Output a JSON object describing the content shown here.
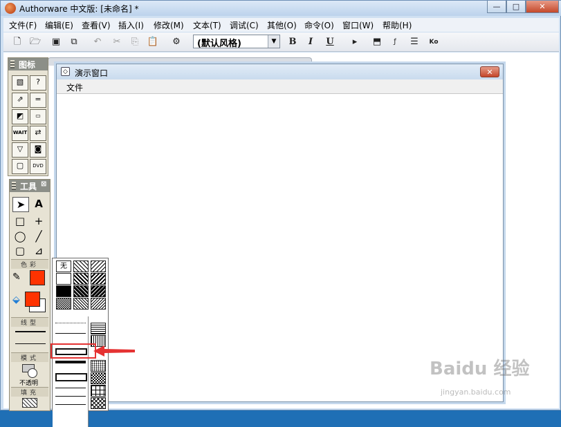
{
  "window": {
    "title": "Authorware 中文版: [未命名] *",
    "caption_buttons": [
      "—",
      "□",
      "✕"
    ]
  },
  "menubar": [
    "文件(F)",
    "编辑(E)",
    "查看(V)",
    "插入(I)",
    "修改(M)",
    "文本(T)",
    "调试(C)",
    "其他(O)",
    "命令(O)",
    "窗口(W)",
    "帮助(H)"
  ],
  "toolbar": {
    "style_select_value": "(默认风格)",
    "bold": "B",
    "italic": "I",
    "underline": "U"
  },
  "icon_palette": {
    "title": "图标"
  },
  "tool_palette": {
    "title": "工具",
    "section_color": "色彩",
    "section_line": "线型",
    "section_mode": "模式",
    "mode_value": "不透明",
    "section_fill": "填充"
  },
  "presentation_window": {
    "title": "演示窗口",
    "menu_file": "文件"
  },
  "fill_popup": {
    "none_label": "无"
  },
  "colors": {
    "accent_red": "#e53232",
    "fill_color_swatch": "#ff3300",
    "stroke_color_swatch": "#ff3300"
  },
  "watermark": {
    "text": "Baidu 经验",
    "sub": "jingyan.baidu.com"
  }
}
